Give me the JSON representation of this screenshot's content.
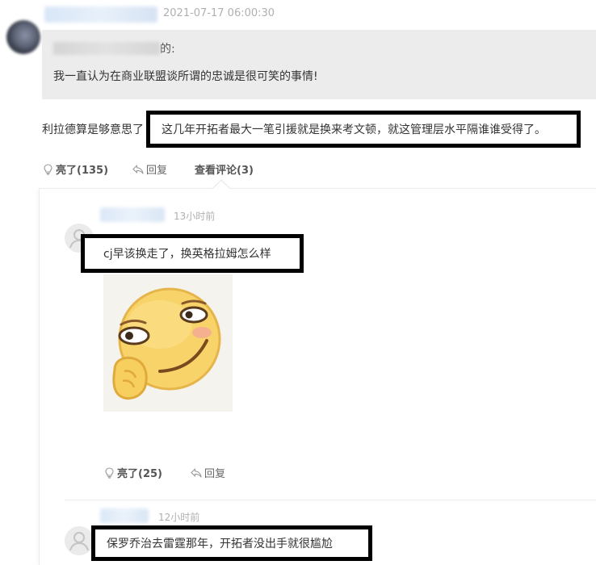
{
  "post": {
    "timestamp": "2021-07-17 06:00:30",
    "quote": {
      "author_suffix": "的:",
      "text": "我一直认为在商业联盟谈所谓的忠诚是很可笑的事情!"
    },
    "reply_prefix": "利拉德算是够意思了",
    "reply_highlight": "这几年开拓者最大一笔引援就是换来考文顿，就这管理层水平隔谁谁受得了。",
    "actions": {
      "like_label": "亮了(135)",
      "reply_label": "回复",
      "view_comments_label": "查看评论(3)"
    }
  },
  "comments": [
    {
      "time": "13小时前",
      "text": "cj早该换走了，换英格拉姆怎么样",
      "sticker_icon": "smirk-emoji-sticker",
      "actions": {
        "like_label": "亮了(25)",
        "reply_label": "回复"
      }
    },
    {
      "time": "12小时前",
      "text": "保罗乔治去雷霆那年，开拓者没出手就很尴尬"
    }
  ],
  "colors": {
    "highlight_border": "#000000",
    "quote_bg": "#ececec",
    "muted_text": "#b0b0b0"
  }
}
